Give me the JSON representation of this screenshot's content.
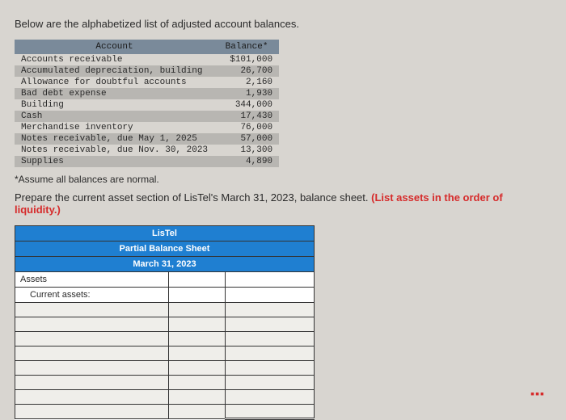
{
  "intro": "Below are the alphabetized list of adjusted account balances.",
  "balances": {
    "header_account": "Account",
    "header_balance": "Balance*",
    "rows": [
      {
        "label": "Accounts receivable",
        "value": "$101,000"
      },
      {
        "label": "Accumulated depreciation, building",
        "value": "26,700"
      },
      {
        "label": "Allowance for doubtful accounts",
        "value": "2,160"
      },
      {
        "label": "Bad debt expense",
        "value": "1,930"
      },
      {
        "label": "Building",
        "value": "344,000"
      },
      {
        "label": "Cash",
        "value": "17,430"
      },
      {
        "label": "Merchandise inventory",
        "value": "76,000"
      },
      {
        "label": "Notes receivable, due May 1, 2025",
        "value": "57,000"
      },
      {
        "label": "Notes receivable, due Nov. 30, 2023",
        "value": "13,300"
      },
      {
        "label": "Supplies",
        "value": "4,890"
      }
    ]
  },
  "footnote": "*Assume all balances are normal.",
  "instruction_pre": "Prepare the current asset section of LisTel's March 31, 2023, balance sheet. ",
  "instruction_hint": "(List assets in the order of liquidity.)",
  "worksheet": {
    "title1": "LisTel",
    "title2": "Partial Balance Sheet",
    "title3": "March 31, 2023",
    "row_assets": "Assets",
    "row_current": "Current assets:"
  }
}
